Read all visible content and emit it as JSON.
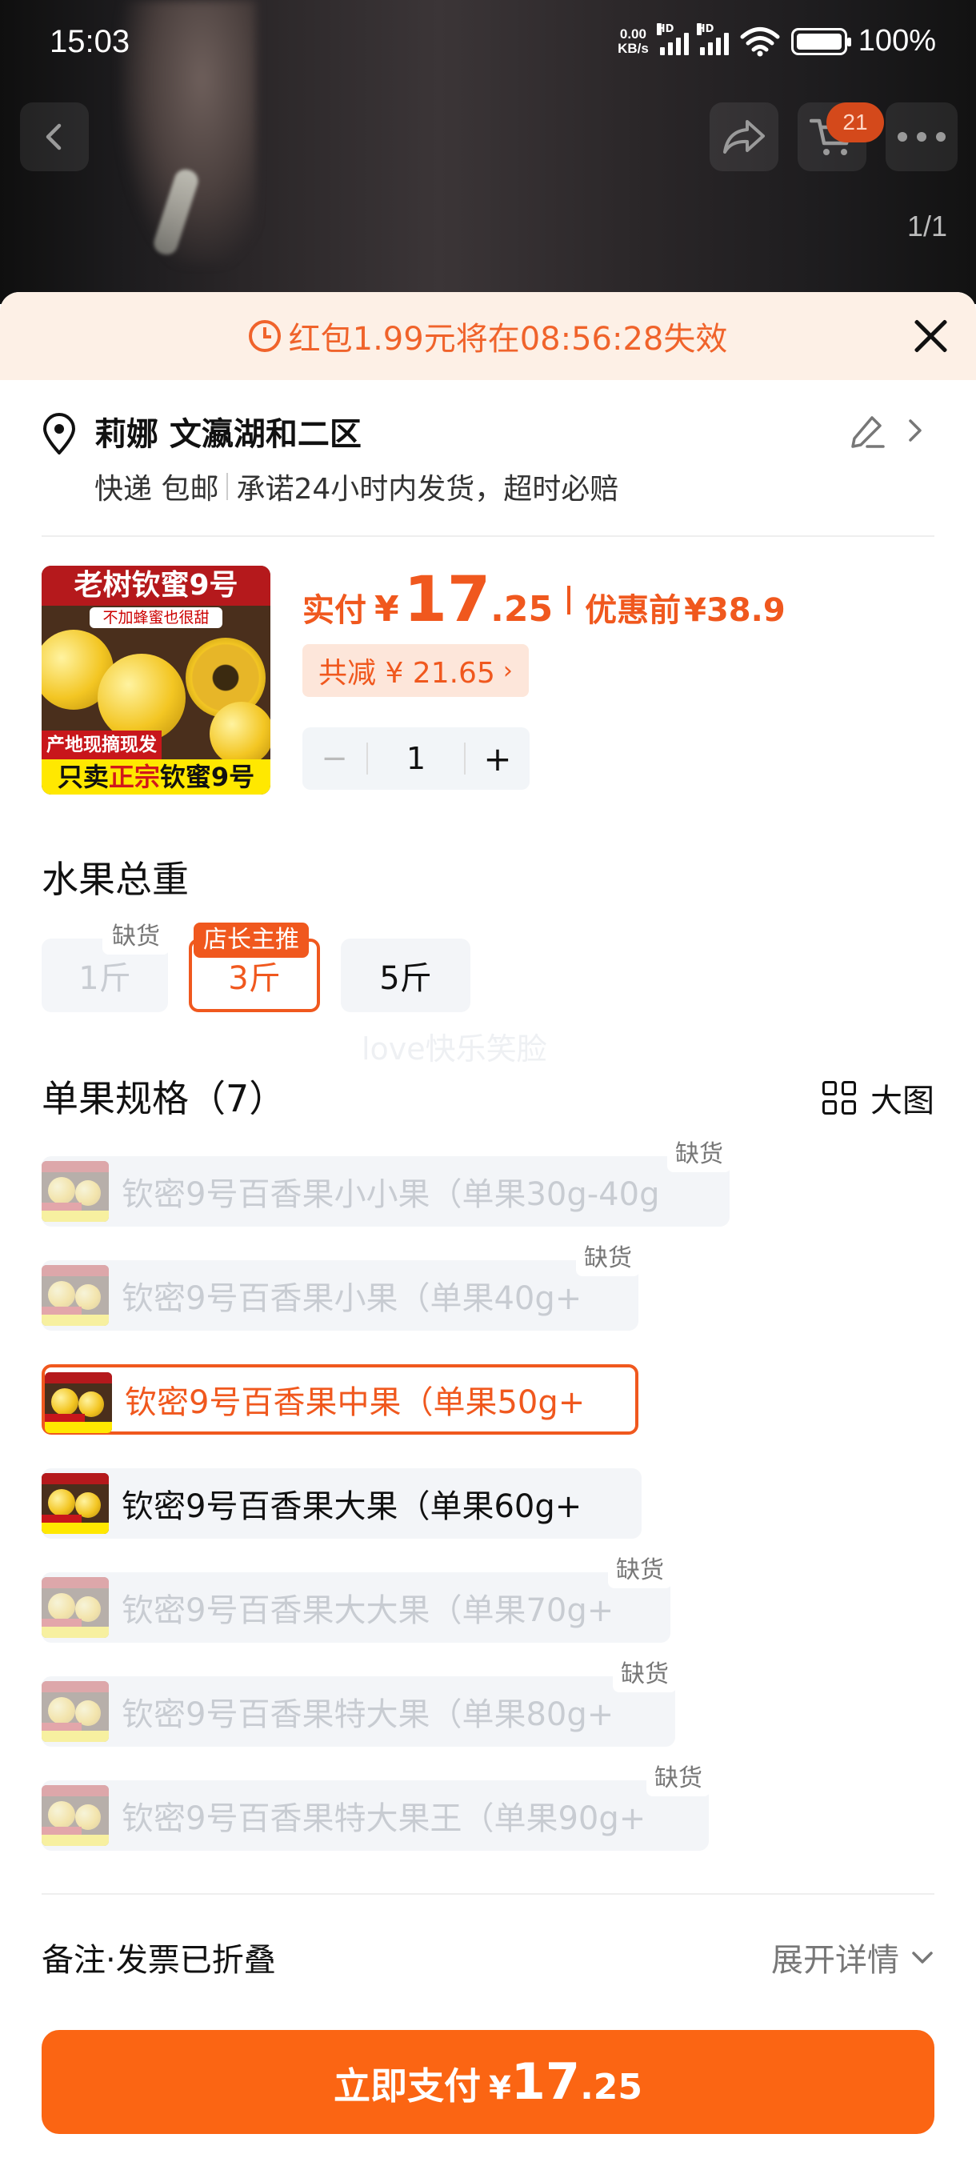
{
  "status_bar": {
    "time": "15:03",
    "net_speed_value": "0.00",
    "net_speed_unit": "KB/s",
    "signal_label": "HD",
    "battery": "100%"
  },
  "nav": {
    "cart_badge": "21",
    "image_counter": "1/1",
    "icons": [
      "back-icon",
      "share-icon",
      "cart-icon",
      "more-icon"
    ]
  },
  "promo": {
    "text": "红包1.99元将在08:56:28失效"
  },
  "address": {
    "name": "莉娜 文瀛湖和二区",
    "shipping": "快递 包邮",
    "promise": "承诺24小时内发货，超时必赔"
  },
  "product": {
    "thumb_title": "老树钦蜜9号",
    "thumb_subtitle": "不加蜂蜜也很甜",
    "thumb_badge": "产地现摘现发",
    "thumb_bottom_pre": "只卖",
    "thumb_bottom_em": "正宗",
    "thumb_bottom_post": "钦蜜9号",
    "pay_label": "实付",
    "currency": "¥",
    "price_int": "17",
    "price_dec": ".25",
    "original_label": "优惠前",
    "original_price": "¥38.9",
    "saving": "共减 ¥ 21.65",
    "quantity": "1",
    "minus": "−",
    "plus": "+"
  },
  "weight": {
    "title": "水果总重",
    "options": [
      {
        "label": "1斤",
        "tag": "缺货",
        "state": "disabled"
      },
      {
        "label": "3斤",
        "tag": "店长主推",
        "state": "selected"
      },
      {
        "label": "5斤",
        "tag": "",
        "state": "normal"
      }
    ],
    "watermark": "love快乐笑脸"
  },
  "spec": {
    "title": "单果规格（7）",
    "bigview": "大图",
    "out_of_stock": "缺货",
    "items": [
      {
        "label": "钦密9号百香果小小果（单果30g-40g",
        "state": "disabled"
      },
      {
        "label": "钦密9号百香果小果（单果40g+",
        "state": "disabled"
      },
      {
        "label": "钦密9号百香果中果（单果50g+",
        "state": "selected"
      },
      {
        "label": "钦密9号百香果大果（单果60g+",
        "state": "normal"
      },
      {
        "label": "钦密9号百香果大大果（单果70g+",
        "state": "disabled"
      },
      {
        "label": "钦密9号百香果特大果（单果80g+",
        "state": "disabled"
      },
      {
        "label": "钦密9号百香果特大果王（单果90g+",
        "state": "disabled"
      }
    ]
  },
  "remark": {
    "left": "备注·发票已折叠",
    "right": "展开详情"
  },
  "pay_button": {
    "label": "立即支付",
    "currency": "¥",
    "int": "17",
    "dec": ".25"
  },
  "colors": {
    "accent": "#f0581e",
    "pay_button": "#fb6513",
    "promo_bg": "#fdf0e6"
  }
}
